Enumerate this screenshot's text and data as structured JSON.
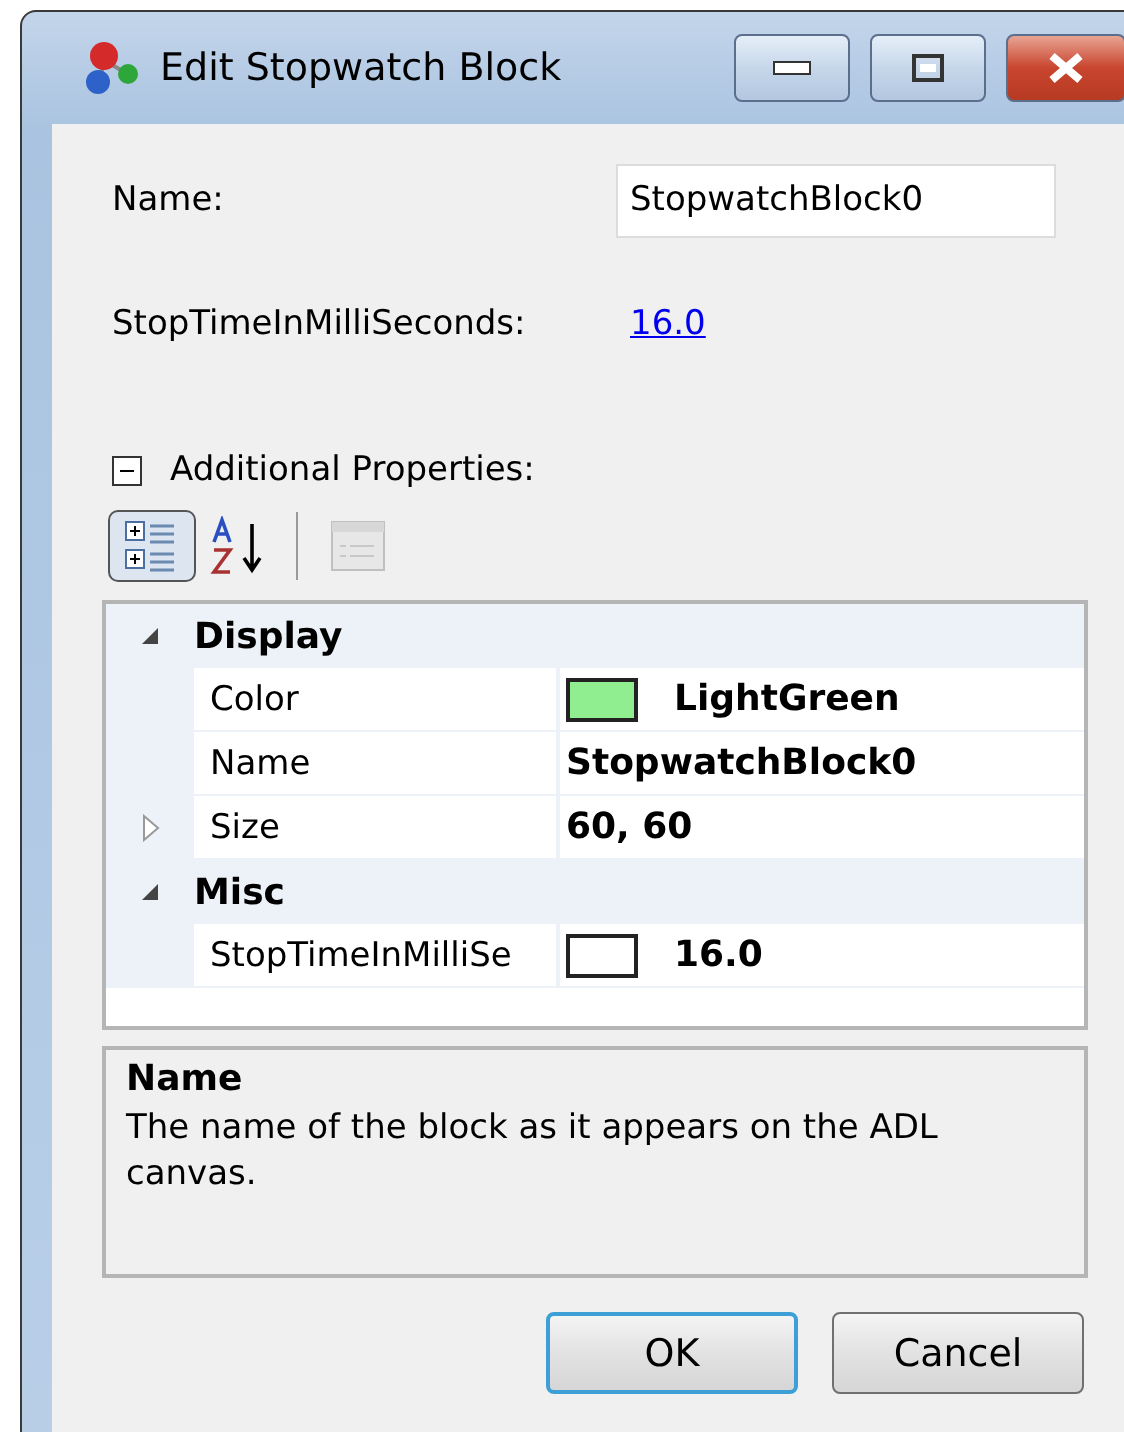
{
  "window": {
    "title": "Edit Stopwatch Block"
  },
  "fields": [
    {
      "label": "Name:",
      "kind": "input",
      "value": "StopwatchBlock0"
    },
    {
      "label": "StopTimeInMilliSeconds:",
      "kind": "link",
      "value": "16.0"
    }
  ],
  "additional_properties": {
    "label": "Additional Properties:",
    "expanded": true
  },
  "toolbar": [
    {
      "kind": "categorized",
      "selected": true,
      "disabled": false
    },
    {
      "kind": "alphabetical",
      "selected": false,
      "disabled": false
    },
    {
      "kind": "property-pages",
      "selected": false,
      "disabled": true
    }
  ],
  "property_grid": [
    {
      "category": "Display",
      "expanded": true,
      "properties": [
        {
          "name": "Color",
          "value": "LightGreen",
          "kind": "swatch",
          "color": "#90ee90"
        },
        {
          "name": "Name",
          "value": "StopwatchBlock0",
          "kind": "plain"
        },
        {
          "name": "Size",
          "value": "60, 60",
          "kind": "expandable",
          "expanded": false
        }
      ]
    },
    {
      "category": "Misc",
      "expanded": true,
      "properties": [
        {
          "name": "StopTimeInMilliSe",
          "value": "16.0",
          "kind": "swatch",
          "color": "#ffffff"
        }
      ]
    }
  ],
  "description": {
    "title": "Name",
    "text": "The name of the block as it appears on the ADL canvas."
  },
  "buttons": [
    {
      "label": "OK",
      "default": true
    },
    {
      "label": "Cancel",
      "default": false
    }
  ]
}
